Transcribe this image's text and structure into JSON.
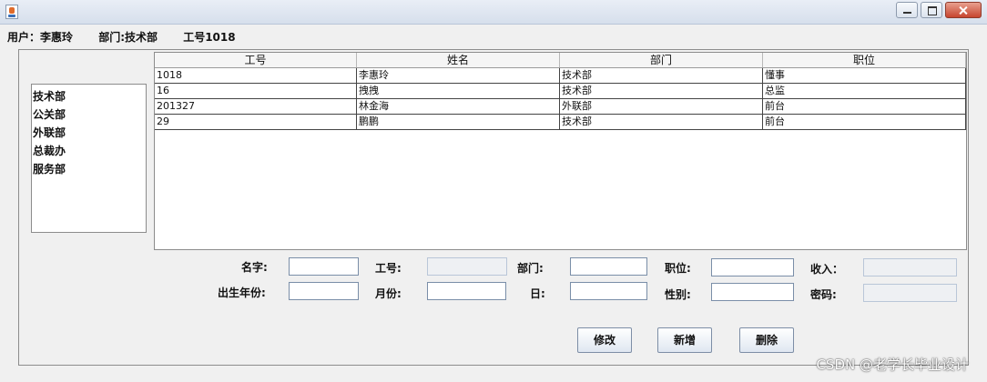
{
  "window": {
    "title": ""
  },
  "user_bar": {
    "user": "用户：李惠玲",
    "dept": "部门:技术部",
    "id": "工号1018"
  },
  "departments": [
    "技术部",
    "公关部",
    "外联部",
    "总裁办",
    "服务部"
  ],
  "table": {
    "headers": [
      "工号",
      "姓名",
      "部门",
      "职位"
    ],
    "rows": [
      [
        "1018",
        "李惠玲",
        "技术部",
        "懂事"
      ],
      [
        "16",
        "拽拽",
        "技术部",
        "总监"
      ],
      [
        "201327",
        "林金海",
        "外联部",
        "前台"
      ],
      [
        "29",
        "鹏鹏",
        "技术部",
        "前台"
      ]
    ]
  },
  "form": {
    "name_label": "名字:",
    "id_label": "工号:",
    "dept_label": "部门:",
    "position_label": "职位:",
    "income_label": "收入：",
    "birth_year_label": "出生年份:",
    "month_label": "月份:",
    "day_label": "日:",
    "gender_label": "性别:",
    "password_label": "密码:"
  },
  "buttons": {
    "modify": "修改",
    "add": "新增",
    "delete": "删除"
  },
  "watermark": "CSDN @老学长毕业设计"
}
